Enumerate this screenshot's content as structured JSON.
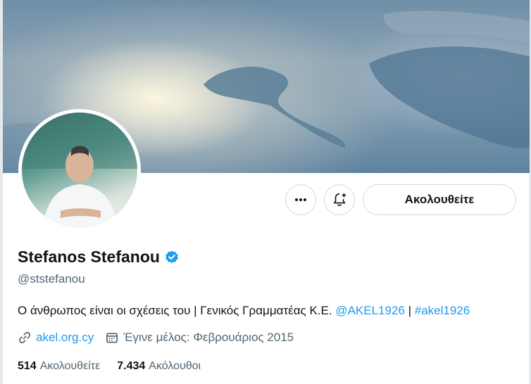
{
  "profile": {
    "name": "Stefanos Stefanou",
    "handle": "@ststefanou",
    "bio_text": "Ο άνθρωπος είναι οι σχέσεις του | Γενικός Γραμματέας Κ.Ε. ",
    "bio_mention": "@AKEL1926",
    "bio_separator": " | ",
    "bio_hashtag": "#akel1926",
    "website": "akel.org.cy",
    "joined": "Έγινε μέλος: Φεβρουάριος 2015",
    "following_count": "514",
    "following_label": "Ακολουθείτε",
    "followers_count": "7.434",
    "followers_label": "Ακόλουθοι"
  },
  "actions": {
    "follow_label": "Ακολουθείτε",
    "more_icon": "more-icon",
    "notify_icon": "bell-plus-icon"
  },
  "colors": {
    "accent": "#1d9bf0",
    "verified": "#1d9bf0",
    "secondary_text": "#536471"
  }
}
